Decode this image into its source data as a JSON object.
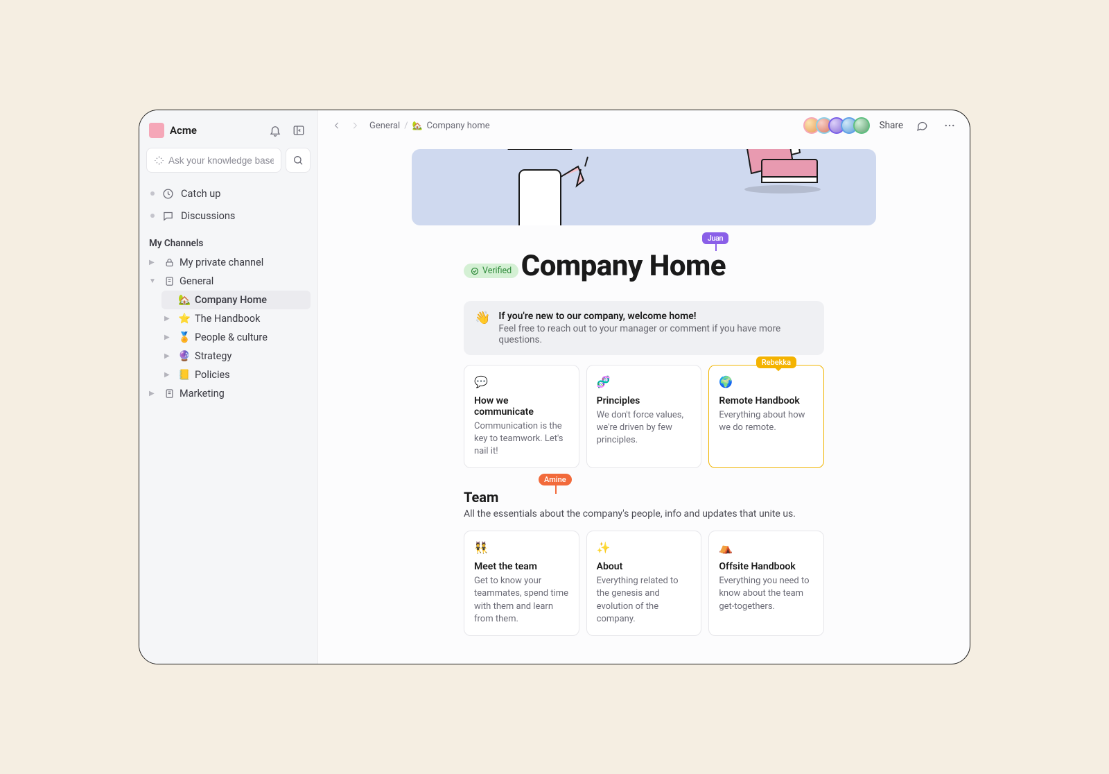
{
  "workspace": {
    "name": "Acme"
  },
  "search": {
    "placeholder": "Ask your knowledge base"
  },
  "sidebar": {
    "quick": [
      {
        "label": "Catch up"
      },
      {
        "label": "Discussions"
      }
    ],
    "section_title": "My Channels",
    "channels": [
      {
        "label": "My private channel",
        "icon": "lock"
      },
      {
        "label": "General",
        "icon": "doc",
        "expanded": true,
        "children": [
          {
            "icon": "🏡",
            "label": "Company Home",
            "active": true
          },
          {
            "icon": "⭐",
            "label": "The Handbook"
          },
          {
            "icon": "🏅",
            "label": "People & culture"
          },
          {
            "icon": "🔮",
            "label": "Strategy"
          },
          {
            "icon": "📒",
            "label": "Policies"
          }
        ]
      },
      {
        "label": "Marketing",
        "icon": "doc"
      }
    ]
  },
  "breadcrumb": {
    "parent": "General",
    "page_icon": "🏡",
    "page": "Company home"
  },
  "topbar": {
    "share": "Share"
  },
  "presence": {
    "title_user": "Juan",
    "card_user": "Rebekka",
    "team_user": "Amine"
  },
  "page": {
    "verified": "Verified",
    "title": "Company Home",
    "welcome": {
      "emoji": "👋",
      "title": "If you're new to our company, welcome home!",
      "subtitle": "Feel free to reach out to your manager or comment if you have more questions."
    },
    "cards_top": [
      {
        "icon": "💬",
        "title": "How we communicate",
        "desc": "Communication is the key to teamwork. Let's nail it!"
      },
      {
        "icon": "🧬",
        "title": "Principles",
        "desc": "We don't force values, we're driven by few principles."
      },
      {
        "icon": "🌍",
        "title": "Remote Handbook",
        "desc": "Everything about how we do remote.",
        "highlight": true
      }
    ],
    "team": {
      "heading": "Team",
      "subheading": "All the essentials about the company's people, info and updates that unite us."
    },
    "cards_team": [
      {
        "icon": "👯",
        "title": "Meet the team",
        "desc": "Get to know your teammates, spend time with them and learn from them."
      },
      {
        "icon": "✨",
        "title": "About",
        "desc": "Everything related to the genesis and evolution of the company."
      },
      {
        "icon": "⛺",
        "title": "Offsite Handbook",
        "desc": "Everything you need to know about the team get-togethers."
      }
    ]
  }
}
